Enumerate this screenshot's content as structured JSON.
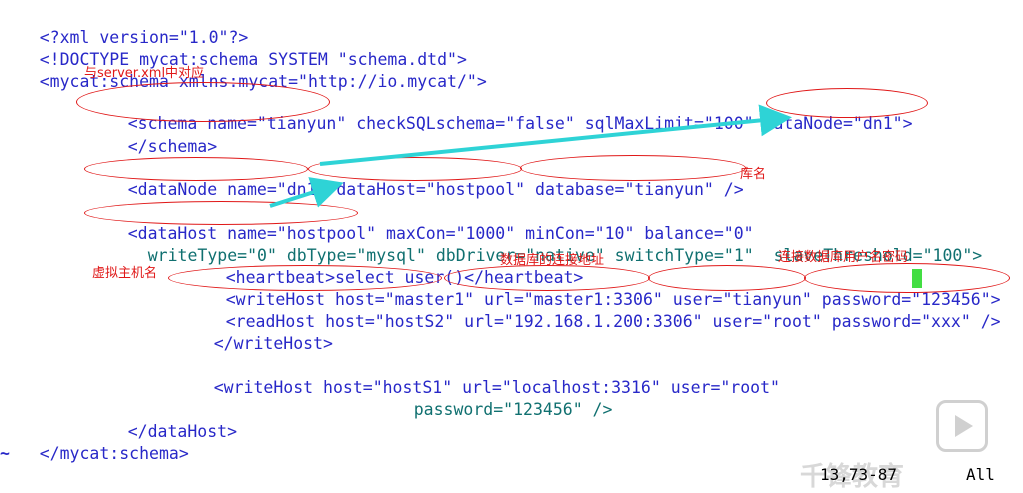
{
  "code": {
    "l1": "<?xml version=\"1.0\"?>",
    "l2": "<!DOCTYPE mycat:schema SYSTEM \"schema.dtd\">",
    "l3": "<mycat:schema xmlns:mycat=\"http://io.mycat/\">",
    "l4": "<schema name=\"tianyun\" checkSQLschema=\"false\" sqlMaxLimit=\"100\" dataNode=\"dn1\">",
    "l5": "</schema>",
    "l6": "<dataNode name=\"dn1\" dataHost=\"hostpool\" database=\"tianyun\" />",
    "l7": "<dataHost name=\"hostpool\" maxCon=\"1000\" minCon=\"10\" balance=\"0\"",
    "l8": "writeType=\"0\" dbType=\"mysql\" dbDriver=\"native\" switchType=\"1\"  slaveThreshold=\"100\">",
    "l9": "<heartbeat>select user()</heartbeat>",
    "l10": "<writeHost host=\"master1\" url=\"master1:3306\" user=\"tianyun\" password=\"123456\">",
    "l11": "<readHost host=\"hostS2\" url=\"192.168.1.200:3306\" user=\"root\" password=\"xxx\" />",
    "l12": "</writeHost>",
    "l13": "<writeHost host=\"hostS1\" url=\"localhost:3316\" user=\"root\"",
    "l14": "password=\"123456\" />",
    "l15": "</dataHost>",
    "l16": "</mycat:schema>",
    "tilde": "~"
  },
  "annotations": {
    "server_xml": "与server.xml中对应",
    "db_name": "库名",
    "db_addr": "数据库的连接地址",
    "virtual_host": "虚拟主机名",
    "db_user_pass": "连接数据库用户名密码"
  },
  "status_bar": {
    "position": "13,73-87",
    "scroll": "All"
  },
  "watermark": {
    "brand": "千锋教育"
  },
  "colors": {
    "tag": "#2828c8",
    "attribute": "#107070",
    "string": "#c83c96",
    "annotation": "#e01818",
    "arrow": "#2ed3d6",
    "cursor": "#22d822"
  }
}
